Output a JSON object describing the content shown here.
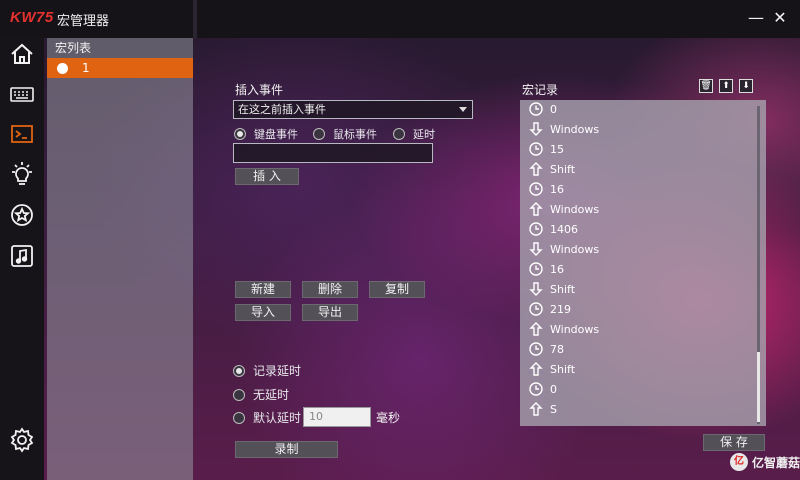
{
  "titlebar": {
    "brand": "KW75",
    "title": "宏管理器",
    "minimize": "—",
    "close": "✕"
  },
  "nav": [
    "home-icon",
    "keyboard-icon",
    "macro-icon",
    "light-icon",
    "star-icon",
    "music-icon",
    "settings-icon"
  ],
  "macro_list": {
    "header": "宏列表",
    "items": [
      {
        "label": "1"
      }
    ]
  },
  "insert": {
    "title": "插入事件",
    "position_select": "在这之前插入事件",
    "event_types": [
      {
        "label": "键盘事件",
        "selected": true
      },
      {
        "label": "鼠标事件",
        "selected": false
      },
      {
        "label": "延时",
        "selected": false
      }
    ],
    "input_value": "",
    "insert_button": "插 入"
  },
  "actions": {
    "new": "新建",
    "delete": "删除",
    "copy": "复制",
    "import": "导入",
    "export": "导出"
  },
  "delay_mode": {
    "options": [
      {
        "label": "记录延时",
        "selected": true
      },
      {
        "label": "无延时",
        "selected": false
      },
      {
        "label": "默认延时",
        "selected": false
      }
    ],
    "default_value_placeholder": "10",
    "unit": "毫秒"
  },
  "record_button": "录制",
  "record": {
    "title": "宏记录",
    "toolbar": {
      "delete": "🗑",
      "up": "⬆",
      "down": "⬇"
    },
    "events": [
      {
        "type": "delay",
        "text": "0"
      },
      {
        "type": "down",
        "text": "Windows"
      },
      {
        "type": "delay",
        "text": "15"
      },
      {
        "type": "up",
        "text": "Shift"
      },
      {
        "type": "delay",
        "text": "16"
      },
      {
        "type": "up",
        "text": "Windows"
      },
      {
        "type": "delay",
        "text": "1406"
      },
      {
        "type": "down",
        "text": "Windows"
      },
      {
        "type": "delay",
        "text": "16"
      },
      {
        "type": "down",
        "text": "Shift"
      },
      {
        "type": "delay",
        "text": "219"
      },
      {
        "type": "up",
        "text": "Windows"
      },
      {
        "type": "delay",
        "text": "78"
      },
      {
        "type": "up",
        "text": "Shift"
      },
      {
        "type": "delay",
        "text": "0"
      },
      {
        "type": "up",
        "text": "S"
      }
    ]
  },
  "save_button": "保 存",
  "watermark": {
    "text": "亿智蘑菇"
  },
  "colors": {
    "accent": "#e06311",
    "brand": "#e5322e"
  }
}
